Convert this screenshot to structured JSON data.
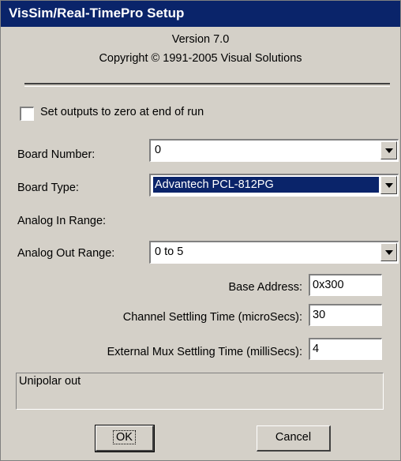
{
  "window": {
    "title": "VisSim/Real-TimePro Setup"
  },
  "header": {
    "version": "Version 7.0",
    "copyright": "Copyright © 1991-2005 Visual Solutions"
  },
  "options": {
    "zero_outputs_label": "Set outputs to  zero at end of run",
    "zero_outputs_checked": false
  },
  "fields": {
    "board_number": {
      "label": "Board Number:",
      "value": "0"
    },
    "board_type": {
      "label": "Board Type:",
      "value": "Advantech PCL-812PG"
    },
    "analog_in_range": {
      "label": "Analog In Range:"
    },
    "analog_out_range": {
      "label": "Analog Out Range:",
      "value": "0 to 5"
    },
    "base_address": {
      "label": "Base Address:",
      "value": "0x300"
    },
    "channel_settling": {
      "label": "Channel Settling Time (microSecs):",
      "value": "30"
    },
    "mux_settling": {
      "label": "External Mux Settling Time (milliSecs):",
      "value": "4"
    }
  },
  "status": {
    "text": "Unipolar out"
  },
  "buttons": {
    "ok": "OK",
    "cancel": "Cancel"
  }
}
